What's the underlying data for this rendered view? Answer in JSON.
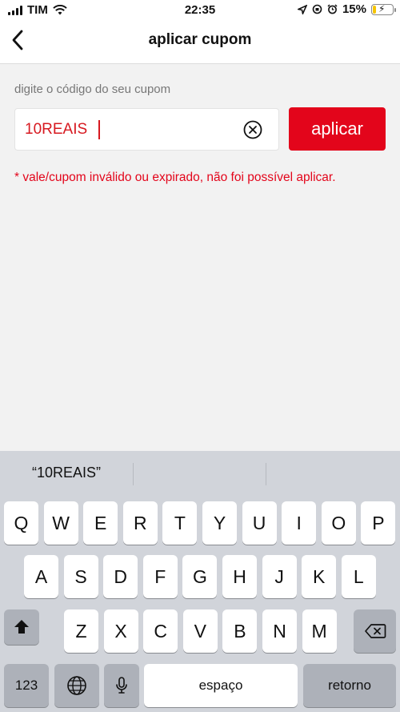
{
  "status_bar": {
    "carrier": "TIM",
    "time": "22:35",
    "battery_percent": "15%",
    "battery_level": 0.15
  },
  "nav": {
    "title": "aplicar cupom",
    "back_icon": "chevron-left-icon"
  },
  "coupon": {
    "label": "digite o código do seu cupom",
    "value": "10REAIS",
    "clear_icon": "clear-circle-icon",
    "apply_label": "aplicar",
    "error": "* vale/cupom inválido ou expirado, não foi possível aplicar."
  },
  "keyboard": {
    "suggestion": "“10REAIS”",
    "row1": [
      "Q",
      "W",
      "E",
      "R",
      "T",
      "Y",
      "U",
      "I",
      "O",
      "P"
    ],
    "row2": [
      "A",
      "S",
      "D",
      "F",
      "G",
      "H",
      "J",
      "K",
      "L"
    ],
    "row3": [
      "Z",
      "X",
      "C",
      "V",
      "B",
      "N",
      "M"
    ],
    "numbers_label": "123",
    "space_label": "espaço",
    "return_label": "retorno"
  },
  "colors": {
    "accent": "#e3051b",
    "input_text": "#d71920"
  }
}
